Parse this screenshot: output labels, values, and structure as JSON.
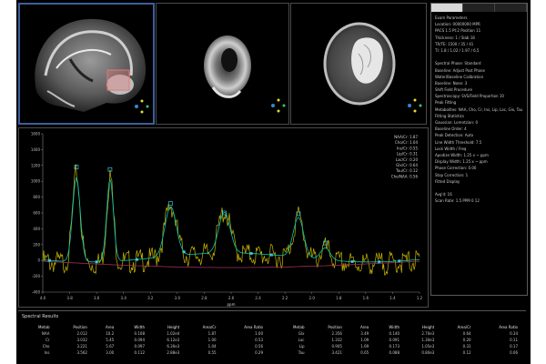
{
  "viewports": [
    {
      "id": "sagittal",
      "label": "",
      "overlay": "rectangular ROI over cerebellum region"
    },
    {
      "id": "axial-low",
      "label": "",
      "overlay": "none"
    },
    {
      "id": "axial-roi",
      "label": "",
      "overlay": "shaded region of interest"
    }
  ],
  "side_panel": {
    "tabs": [
      "",
      "",
      ""
    ],
    "active_tab": 0,
    "lines": [
      "Exam Parameters",
      "Location: 00000000 MPR",
      "PACS 1.5 Pt:2 Position 11",
      "Thickness: 1 / Slab 18",
      "TR/TE: 1500 / 35 / 41",
      "TI: 1.8 / 1.02 / 1.97 / 6.5",
      "",
      "Spectral Phase: Standard",
      "Baseline: Adjust Post Phase",
      "Water/Baseline Calibration",
      "Baseline: None: 3",
      "Shift Field Procedure",
      "Spectroscopy: SVS/Field Proportion 10",
      "Peak Fitting",
      "Metabolites: NAA, Cho, Cr, Ins, Lip, Lac, Glx, Tau",
      "Fitting Statistics",
      "Gaussian: Lorentzian: 0",
      "Baseline Order: 4",
      "Peak Detection: Auto",
      "Line Width Threshold: 7.5",
      "Lock Width / Freq",
      "Apodize Width: 1.25 x ~ ppm",
      "Display Width: 1.25 x ~ ppm",
      "Phase Correction: 0.00",
      "Stop Correction: 1",
      "Fitted Display",
      "",
      "Avg'd: 16",
      "Scan Rate: 1.5 PPM 0 12"
    ]
  },
  "legend": [
    "NAA/Cr: 1.87",
    "Cho/Cr: 1.04",
    "Ins/Cr: 0.55",
    "Lip/Cr: 0.31",
    "Lac/Cr: 0.20",
    "Glx/Cr: 0.64",
    "Tau/Cr: 0.12",
    "Cho/NAA: 0.56"
  ],
  "chart_data": {
    "type": "line",
    "title": "",
    "xlabel": "ppm",
    "ylabel": "",
    "y_ticks": [
      "1600",
      "1400",
      "1200",
      "1000",
      "800",
      "600",
      "400",
      "200",
      "0",
      "-200",
      "-400"
    ],
    "x_ticks": [
      "4.0",
      "3.8",
      "3.6",
      "3.4",
      "3.2",
      "3.0",
      "2.8",
      "2.6",
      "2.4",
      "2.2",
      "2.0",
      "1.8",
      "1.6",
      "1.4",
      "1.2"
    ],
    "grid": false,
    "legend_position": "top-right",
    "colors": {
      "raw": "#c8b400",
      "fit": "#00c8b4",
      "baseline": "#a0305a",
      "markers": "#44e0ff"
    },
    "series": [
      {
        "name": "",
        "kind": "raw"
      },
      {
        "name": "",
        "kind": "fit"
      },
      {
        "name": "",
        "kind": "baseline"
      }
    ],
    "peaks": [
      {
        "x": 3.75,
        "y": 1180
      },
      {
        "x": 3.5,
        "y": 1150
      },
      {
        "x": 3.05,
        "y": 720
      },
      {
        "x": 2.65,
        "y": 600
      },
      {
        "x": 2.1,
        "y": 590
      },
      {
        "x": 1.9,
        "y": 220
      }
    ]
  },
  "results": {
    "title": "Spectral Results",
    "columns": [
      "Metab",
      "Position",
      "Area",
      "Width",
      "Height",
      "Area/Cr",
      "Area Ratio"
    ],
    "left_rows": [
      [
        "NAA",
        "2.012",
        "10.2",
        "0.108",
        "1.02e4",
        "1.87",
        "1.00"
      ],
      [
        "Cr",
        "3.032",
        "5.45",
        "0.094",
        "6.12e3",
        "1.00",
        "0.53"
      ],
      [
        "Cho",
        "3.221",
        "5.67",
        "0.097",
        "6.30e3",
        "1.04",
        "0.56"
      ],
      [
        "Ins",
        "3.562",
        "3.00",
        "0.112",
        "2.88e3",
        "0.55",
        "0.29"
      ]
    ],
    "right_rows": [
      [
        "Glx",
        "2.356",
        "3.49",
        "0.140",
        "2.70e3",
        "0.64",
        "0.34"
      ],
      [
        "Lac",
        "1.332",
        "1.09",
        "0.091",
        "1.30e3",
        "0.20",
        "0.11"
      ],
      [
        "Lip",
        "0.905",
        "1.69",
        "0.173",
        "1.05e3",
        "0.31",
        "0.17"
      ],
      [
        "Tau",
        "3.421",
        "0.65",
        "0.088",
        "0.80e3",
        "0.12",
        "0.06"
      ]
    ]
  }
}
